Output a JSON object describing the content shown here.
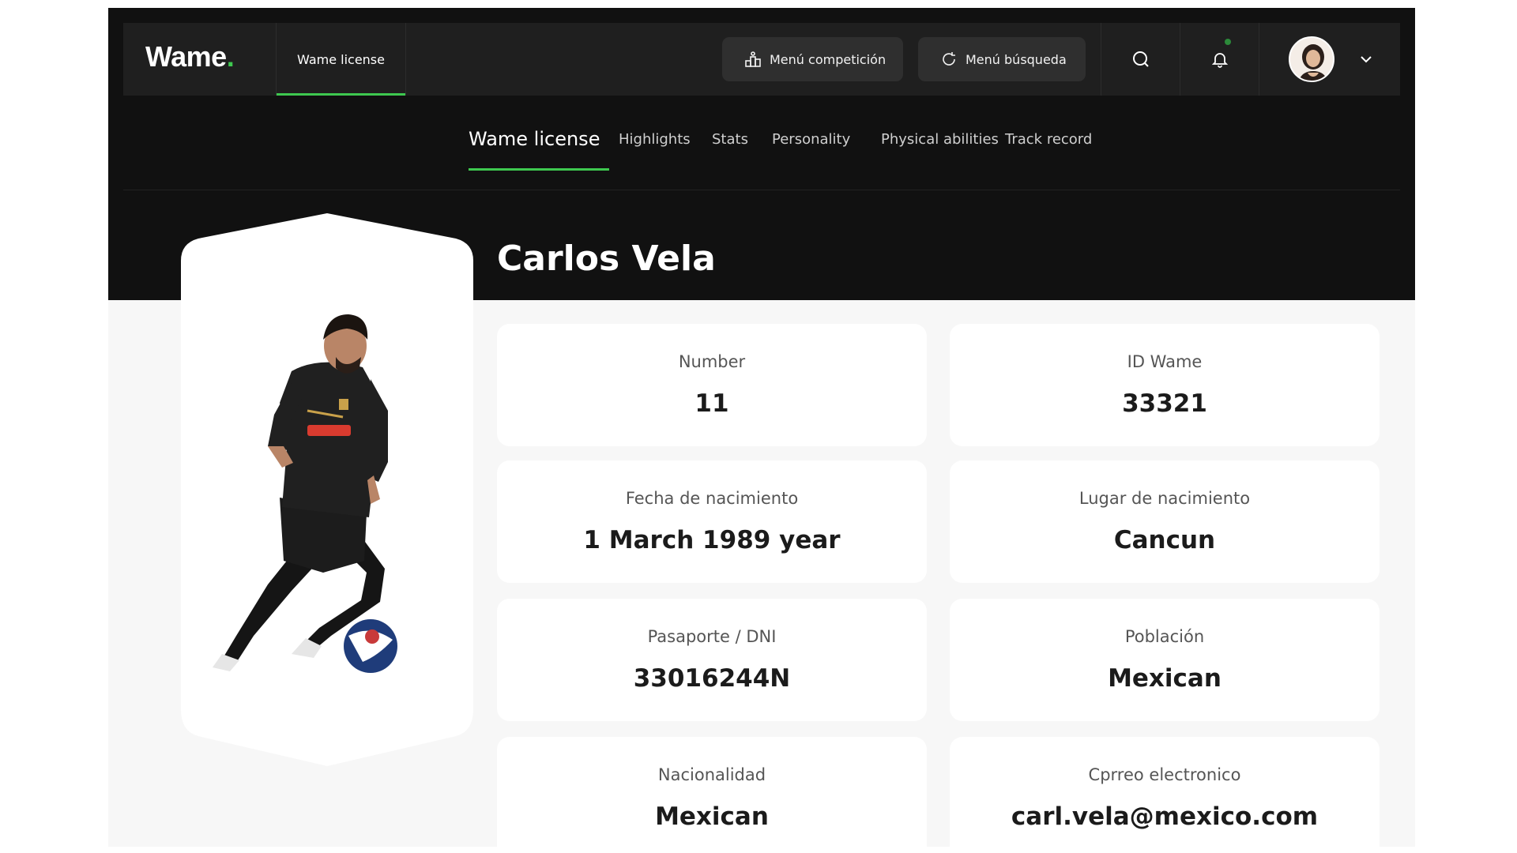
{
  "nav": {
    "logo": "Wame",
    "logo_dot": ".",
    "active_tab": "Wame license",
    "competition_button": "Menú competición",
    "search_menu_button": "Menú búsqueda"
  },
  "subnav": {
    "tabs": [
      {
        "label": "Wame license"
      },
      {
        "label": "Highlights"
      },
      {
        "label": "Stats"
      },
      {
        "label": "Personality"
      },
      {
        "label": "Physical abilities"
      },
      {
        "label": "Track record"
      }
    ]
  },
  "player": {
    "name": "Carlos Vela"
  },
  "fields": [
    {
      "label": "Number",
      "value": "11"
    },
    {
      "label": "ID Wame",
      "value": "33321"
    },
    {
      "label": "Fecha de nacimiento",
      "value": "1 March 1989 year"
    },
    {
      "label": "Lugar de nacimiento",
      "value": "Cancun"
    },
    {
      "label": "Pasaporte / DNI",
      "value": "33016244N"
    },
    {
      "label": "Población",
      "value": "Mexican"
    },
    {
      "label": "Nacionalidad",
      "value": "Mexican"
    },
    {
      "label": "Cprreo electronico",
      "value": "carl.vela@mexico.com"
    }
  ],
  "colors": {
    "accent": "#3ec84f",
    "dark_background": "#111111",
    "nav_background": "#1f1f1f"
  }
}
